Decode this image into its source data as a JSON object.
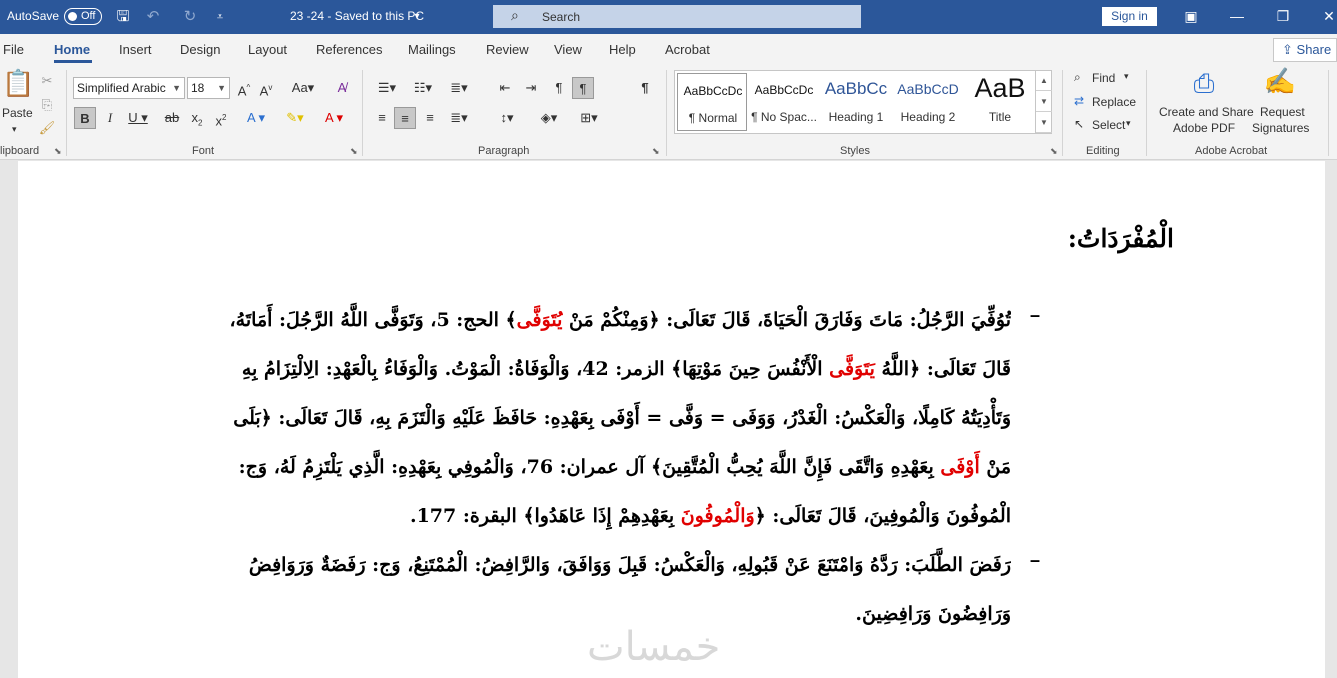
{
  "titlebar": {
    "autosave_label": "AutoSave",
    "autosave_state": "Off",
    "doc_title": "23 -24  -  Saved to this PC",
    "search_placeholder": "Search",
    "signin_label": "Sign in"
  },
  "menu": {
    "tabs": [
      "File",
      "Home",
      "Insert",
      "Design",
      "Layout",
      "References",
      "Mailings",
      "Review",
      "View",
      "Help",
      "Acrobat"
    ],
    "active": "Home",
    "share_label": "Share"
  },
  "ribbon": {
    "clipboard": {
      "paste_label": "Paste",
      "group_label": "lipboard"
    },
    "font": {
      "font_name": "Simplified Arabic",
      "font_size": "18",
      "group_label": "Font"
    },
    "paragraph": {
      "group_label": "Paragraph"
    },
    "styles": {
      "items": [
        {
          "sample": "AaBbCcDc",
          "name": "¶ Normal"
        },
        {
          "sample": "AaBbCcDc",
          "name": "¶ No Spac..."
        },
        {
          "sample": "AaBbCc",
          "name": "Heading 1"
        },
        {
          "sample": "AaBbCcD",
          "name": "Heading 2"
        },
        {
          "sample": "AaB",
          "name": "Title"
        }
      ],
      "group_label": "Styles"
    },
    "editing": {
      "find": "Find",
      "replace": "Replace",
      "select": "Select",
      "group_label": "Editing"
    },
    "acrobat": {
      "create_share": "Create and Share",
      "adobe_pdf": "Adobe PDF",
      "request": "Request",
      "signatures": "Signatures",
      "group_label": "Adobe Acrobat"
    }
  },
  "document": {
    "heading": "الْمُفْرَدَاتُ:",
    "para1": [
      [
        "تُوُفِّيَ الرَّجُلُ: مَاتَ وَفَارَقَ الْحَيَاةَ، قَالَ تَعَالَى: ﴿وَمِنْكُمْ مَنْ ",
        "يُتَوَفَّى",
        "﴾ الحج: 5، وَتَوَفَّى اللَّهُ الرَّجُلَ: أَمَاتَهُ،"
      ],
      [
        "قَالَ تَعَالَى: ﴿اللَّهُ ",
        "يَتَوَفَّى",
        " الْأَنْفُسَ حِينَ مَوْتِهَا﴾ الزمر: 42، وَالْوَفَاةُ: الْمَوْتُ. وَالْوَفَاءُ بِالْعَهْدِ: الِالْتِزَامُ بِهِ"
      ],
      [
        "وَتَأْدِيَتُهُ كَامِلًا، وَالْعَكْسُ: الْغَدْرُ، وَوَفَى = وَفَّى = أَوْفَى بِعَهْدِهِ: حَافَظَ عَلَيْهِ وَالْتَزَمَ بِهِ، قَالَ تَعَالَى: ﴿بَلَى",
        "",
        ""
      ],
      [
        "مَنْ ",
        "أَوْفَى",
        " بِعَهْدِهِ وَاتَّقَى فَإِنَّ اللَّهَ يُحِبُّ الْمُتَّقِينَ﴾ آل عمران: 76، وَالْمُوفِي بِعَهْدِهِ: الَّذِي يَلْتَزِمُ لَهُ، وَج:"
      ],
      [
        "الْمُوفُونَ وَالْمُوفِينَ، قَالَ تَعَالَى: ﴿",
        "وَالْمُوفُونَ",
        " بِعَهْدِهِمْ إِذَا عَاهَدُوا﴾ البقرة: 177."
      ]
    ],
    "para2": [
      "رَفَضَ الطَّلَبَ: رَدَّهُ وَامْتَنَعَ عَنْ قَبُولِهِ، وَالْعَكْسُ: قَبِلَ وَوَافَقَ، وَالرَّافِضُ: الْمُمْتَنِعُ، وَج: رَفَضَةٌ وَرَوَافِضُ",
      "وَرَافِضُونَ وَرَافِضِينَ."
    ],
    "dash": "–",
    "watermark": "خمسات"
  },
  "colors": {
    "accent": "#2b579a",
    "highlight_red": "#e00000"
  }
}
